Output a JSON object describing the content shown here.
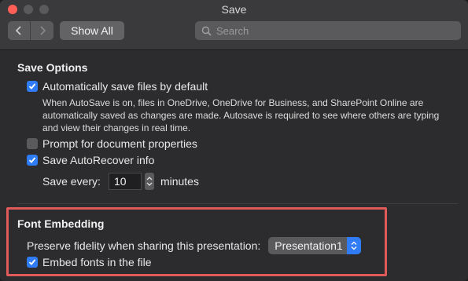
{
  "window": {
    "title": "Save"
  },
  "toolbar": {
    "show_all_label": "Show All",
    "search_placeholder": "Search"
  },
  "save_options": {
    "heading": "Save Options",
    "autosave": {
      "label": "Automatically save files by default",
      "checked": true,
      "description": "When AutoSave is on, files in OneDrive, OneDrive for Business, and SharePoint Online are automatically saved as changes are made. Autosave is required to see where others are typing and view their changes in real time."
    },
    "prompt_properties": {
      "label": "Prompt for document properties",
      "checked": false
    },
    "autorecover": {
      "label": "Save AutoRecover info",
      "checked": true
    },
    "save_every": {
      "label": "Save every:",
      "value": "10",
      "unit": "minutes"
    }
  },
  "font_embedding": {
    "heading": "Font Embedding",
    "preserve_label": "Preserve fidelity when sharing this presentation:",
    "presentation_select": "Presentation1",
    "embed_fonts": {
      "label": "Embed fonts in the file",
      "checked": true
    }
  },
  "colors": {
    "accent": "#2f7cf6",
    "highlight_border": "#e15a5a",
    "close_button": "#ff5f57"
  },
  "icons": {
    "back": "chevron-left-icon",
    "forward": "chevron-right-icon",
    "search": "search-icon",
    "checkmark": "checkmark-icon",
    "stepper": "stepper-icon",
    "popup": "popup-arrows-icon"
  }
}
